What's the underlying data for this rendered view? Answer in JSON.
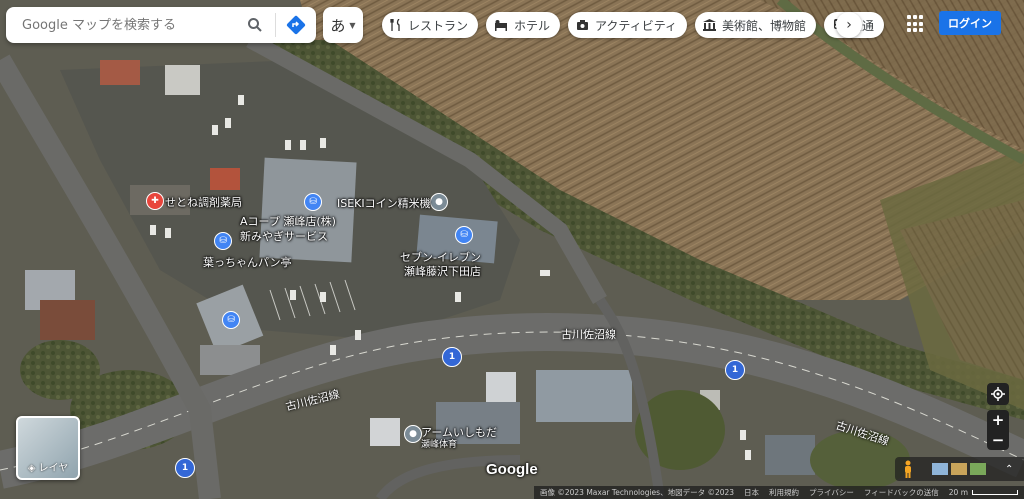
{
  "search": {
    "placeholder": "Google マップを検索する"
  },
  "ime": {
    "label": "あ"
  },
  "chips": [
    {
      "label": "レストラン",
      "icon": "fork-knife-icon"
    },
    {
      "label": "ホテル",
      "icon": "bed-icon"
    },
    {
      "label": "アクティビティ",
      "icon": "camera-icon"
    },
    {
      "label": "美術館、博物館",
      "icon": "museum-icon"
    },
    {
      "label": "交通",
      "icon": "train-icon"
    }
  ],
  "login": {
    "label": "ログイン"
  },
  "places": {
    "pharmacy": "せとね調剤薬局",
    "coop": "Aコープ 瀬峰店(株)",
    "coop2": "新みやぎサービス",
    "bakery": "葉っちゃんパン亭",
    "rice": "ISEKIコイン精米機",
    "seven": "セブン-イレブン",
    "seven2": "瀬峰藤沢下田店",
    "armshop": "アームいしもだ",
    "armshop2": "瀬峰体育"
  },
  "roads": {
    "r1": "古川佐沼線",
    "r2": "古川佐沼線",
    "r3": "古川佐沼線"
  },
  "route_badges": [
    "1",
    "1",
    "1"
  ],
  "layers": {
    "label": "レイヤ"
  },
  "google": "Google",
  "attribution": {
    "imagery": "画像 ©2023 Maxar Technologies、地図データ ©2023",
    "country": "日本",
    "terms": "利用規約",
    "privacy": "プライバシー",
    "feedback": "フィードバックの送信",
    "scale": "20 m"
  },
  "colors": {
    "accent": "#1a73e8",
    "route": "#3367d6",
    "pharmacy": "#e8453c",
    "shop": "#4285f4"
  }
}
